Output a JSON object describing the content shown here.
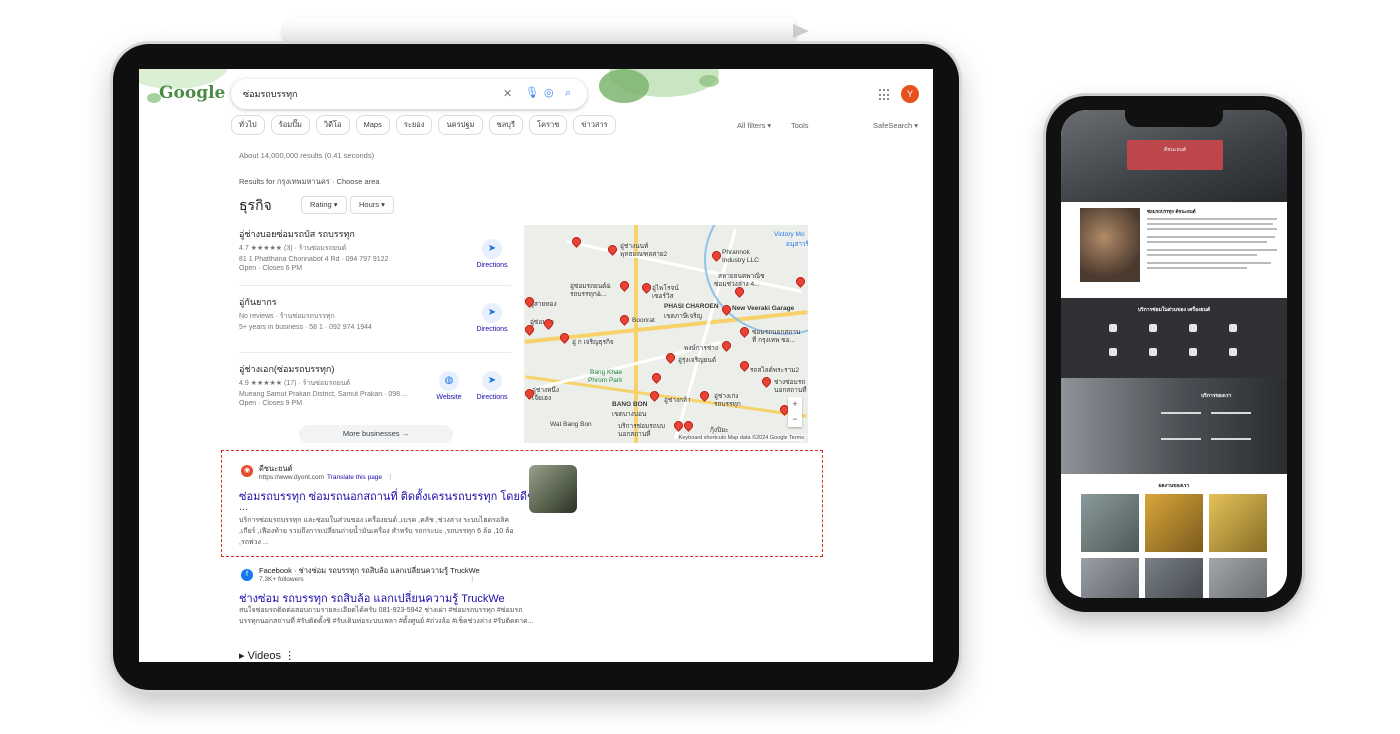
{
  "google": {
    "logo_text": "Google",
    "query": "ซ่อมรถบรรทุก",
    "avatar_letter": "Y",
    "chips": [
      "ทั่วไป",
      "ร้อมปั๊ม",
      "วิดีโอ",
      "Maps",
      "ระยอง",
      "นครปฐม",
      "ชลบุรี",
      "โคราช",
      "ข่าวสาร"
    ],
    "all_filters": "All filters",
    "tools": "Tools",
    "safesearch": "SafeSearch",
    "result_stats": "About 14,000,000 results (0.41 seconds)",
    "results_for": "Results for กรุงเทพมหานคร · Choose area"
  },
  "business": {
    "section_title": "ธุรกิจ",
    "filters": [
      "Rating",
      "Hours"
    ],
    "listings": [
      {
        "name": "อู่ช่างบอยซ่อมรถบัส รถบรรทุก",
        "rating_text": "4.7 ★★★★★ (3) · ร้านซ่อมรถยนต์",
        "address": "81 1 Phatthana Chonnabot 4 Rd · 094 797 9122",
        "hours": "Open · Closes 6 PM",
        "actions": [
          "Directions"
        ]
      },
      {
        "name": "อู่กันยากร",
        "rating_text": "No reviews · ร้านซ่อมรถบรรทุก",
        "address": "5+ years in business · 58 1 · 092 974 1944",
        "hours": "",
        "actions": [
          "Directions"
        ]
      },
      {
        "name": "อู่ช่างเอก(ซ่อมรถบรรทุก)",
        "rating_text": "4.9 ★★★★★ (17) · ร้านซ่อมรถยนต์",
        "address": "Mueang Samut Prakan District, Samut Prakan · 098 ...",
        "hours": "Open · Closes 9 PM",
        "actions": [
          "Website",
          "Directions"
        ]
      }
    ],
    "more_button": "More businesses"
  },
  "map": {
    "labels": [
      "Victory Mo",
      "อนุสาวรีย์",
      "อู่ช่างนนท์",
      "พุทธมณฑลสาย2",
      "Phrannok",
      "Industry LLC",
      "สหายยนตพาณิช",
      "ซ่อมช่วงล่าง 4...",
      "อู่ซ่อมรถยนต์&",
      "รถบรรทุก&...",
      "อู่ไพโรจน์",
      "เซอร์วิส",
      "PHASI CHAROEN",
      "เขตภาษีเจริญ",
      "New Veeraki Garage",
      "อู่สายทอง",
      "Boonrat",
      "อู่ซ่อมรถ",
      "อู่ ก เจริญธุรกิจ",
      "ซ่อมรถนอกสถาน",
      "ที่ กรุงเทพ ซอ...",
      "พงษ์การช่าง",
      "อู่รุ่งเจริญยนต์",
      "Bang Khae",
      "Phrom Park",
      "รถสไลด์พระราม2",
      "อู่ช่างหนึ่ง",
      "เจียเฮง",
      "อู่ช่างกล้า",
      "อู่ช่างเก่ง",
      "รถบรรทุก",
      "ช่างซ่อมรถ",
      "นอกสถานที่",
      "BANG BON",
      "เขตบางบอน",
      "Wat Bang Bon",
      "บริการซ่อมรถบบ",
      "นอกสถานที่",
      "กุ้งปิยะ"
    ],
    "zoom_in": "+",
    "zoom_out": "−",
    "credits": "Keyboard shortcuts   Map data ©2024 Google   Terms"
  },
  "result1": {
    "site": "ดีชนะยนต์",
    "url": "https://www.dyont.com",
    "translate": "Translate this page",
    "title": "ซ่อมรถบรรทุก ซ่อมรถนอกสถานที่ ติดตั้งเครนรถบรรทุก โดยดีชนะ",
    "title_cont": "...",
    "snippet": [
      "บริการซ่อมรถบรรทุก และซ่อมในส่วนของ เครื่องยนต์ ,เบรค ,คลัช ,ช่วงล่าง ระบบไฮดรอลิค",
      ",เกียร์ ,เฟืองท้าย รวมถึงการเปลี่ยนถ่ายน้ำมันเครื่อง สำหรับ รถกระบะ ,รถบรรทุก 6 ล้อ ,10 ล้อ",
      ",รถพ่วง ..."
    ]
  },
  "result2": {
    "site": "Facebook · ช่างซ่อม รถบรรทุก รถสิบล้อ แลกเปลี่ยนความรู้ TruckWe",
    "followers": "7.3K+ followers",
    "title": "ช่างซ่อม รถบรรทุก รถสิบล้อ แลกเปลี่ยนความรู้ TruckWe",
    "snippet": [
      "สนใจซ่อมรถติดต่อสอบถามรายละเอียดได้ครับ 081-923-5942 ช่างเผ่า #ซ่อมรถบรรทุก #ซ่อมรถ",
      "บรรทุกนอกสถานที่ #รับติดตั้งชิ #รับเดินท่อระบบเพลา #ตั้งศูนย์ #ถ่วงล้อ #เช็คช่วงล่าง #รับติดตาค..."
    ]
  },
  "videos_heading": "Videos",
  "phone": {
    "hero_badge": "ดีชนะยนต์",
    "about_title": "ซ่อมรถบรรทุก ดีชนะยนต์",
    "services_title": "บริการซ่อมในส่วนของ เครื่องยนต์",
    "services": [
      "เครื่องยนต์",
      "เบรค",
      "คลัช",
      "ช่วงล่าง",
      "ระบบไฮดรอลิค",
      "เกียร์",
      "เฟืองท้าย",
      "เปลี่ยนถ่ายน้ำมันเครื่อง"
    ],
    "mech_title": "บริการของเรา",
    "gallery_title": "ผลงานของเรา"
  },
  "colors": {
    "link": "#1a0dab",
    "highlight_border": "#d93025",
    "pin": "#ea4335",
    "avatar": "#e8511d"
  }
}
